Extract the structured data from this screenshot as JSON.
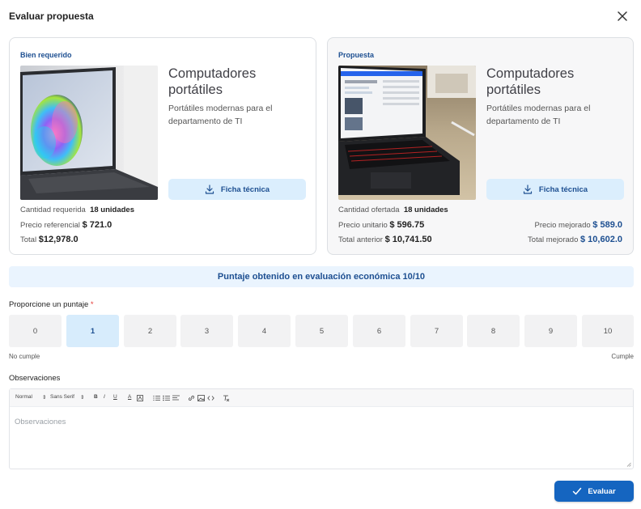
{
  "dialog": {
    "title": "Evaluar propuesta"
  },
  "required": {
    "label": "Bien requerido",
    "name": "Computadores portátiles",
    "description": "Portátiles modernas para el departamento de TI",
    "ficha": "Ficha técnica",
    "qty_label": "Cantidad requerida",
    "qty_value": "18 unidades",
    "price_label": "Precio referencial",
    "price_value": "$ 721.0",
    "total_label": "Total",
    "total_value": "$12,978.0"
  },
  "proposal": {
    "label": "Propuesta",
    "name": "Computadores portátiles",
    "description": "Portátiles modernas para el departamento de TI",
    "ficha": "Ficha técnica",
    "qty_label": "Cantidad ofertada",
    "qty_value": "18 unidades",
    "unit_label": "Precio unitario",
    "unit_value": "$ 596.75",
    "prev_total_label": "Total anterior",
    "prev_total_value": "$ 10,741.50",
    "improved_price_label": "Precio mejorado",
    "improved_price_value": "$ 589.0",
    "improved_total_label": "Total mejorado",
    "improved_total_value": "$ 10,602.0"
  },
  "score_banner": "Puntaje obtenido en evaluación económica 10/10",
  "score": {
    "label": "Proporcione un puntaje",
    "required_mark": "*",
    "options": [
      "0",
      "1",
      "2",
      "3",
      "4",
      "5",
      "6",
      "7",
      "8",
      "9",
      "10"
    ],
    "selected": "1",
    "min_hint": "No cumple",
    "max_hint": "Cumple"
  },
  "observations": {
    "label": "Observaciones",
    "placeholder": "Observaciones",
    "toolbar": {
      "format": "Normal",
      "font": "Sans Serif",
      "bold": "B",
      "italic": "I",
      "underline": "U",
      "color": "A"
    }
  },
  "submit": "Evaluar",
  "colors": {
    "accent": "#1565c0",
    "accent_light": "#dbeefd",
    "text_blue": "#1d4f91"
  }
}
